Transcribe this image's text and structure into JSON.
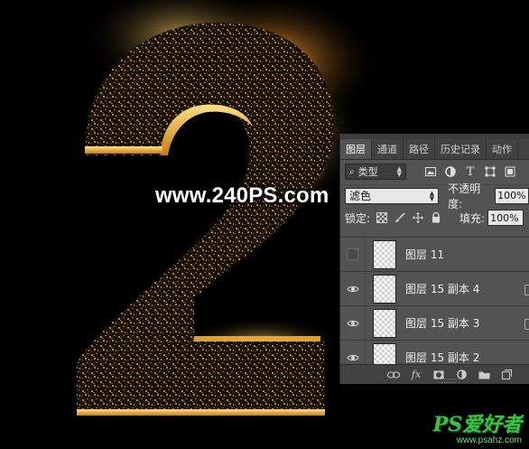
{
  "artwork": {
    "watermark_text": "www.240PS.com",
    "glyph": "2"
  },
  "logo": {
    "main": "PS爱好者",
    "sub": "www.psahz.com"
  },
  "layers_panel": {
    "tabs": [
      {
        "label": "图层",
        "active": true
      },
      {
        "label": "通道",
        "active": false
      },
      {
        "label": "路径",
        "active": false
      },
      {
        "label": "历史记录",
        "active": false
      },
      {
        "label": "动作",
        "active": false
      }
    ],
    "filter": {
      "kind_value": "类型",
      "icons": [
        "image-filter-icon",
        "adjustment-filter-icon",
        "type-filter-icon",
        "shape-filter-icon",
        "smart-object-filter-icon"
      ]
    },
    "blend_mode": "滤色",
    "opacity_label": "不透明度:",
    "opacity_value": "100%",
    "lock_label": "锁定:",
    "fill_label": "填充:",
    "fill_value": "100%",
    "layers": [
      {
        "name": "图层 11",
        "visible": false
      },
      {
        "name": "图层 15 副本 4",
        "visible": true
      },
      {
        "name": "图层 15 副本 3",
        "visible": true
      },
      {
        "name": "图层 15 副本 2",
        "visible": true
      }
    ],
    "bottom_icons": [
      "link-layers-icon",
      "fx-icon",
      "add-mask-icon",
      "adjustment-layer-icon",
      "new-group-icon",
      "new-layer-icon"
    ]
  }
}
